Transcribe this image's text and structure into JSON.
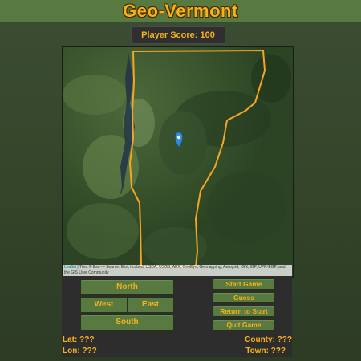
{
  "app": {
    "title": "Geo-Vermont",
    "score_label": "Player Score: 100"
  },
  "map": {
    "attribution_link": "Leaflet",
    "attribution_text": " | Tiles © Esri — Source: Esri, i-cubed, USDA, USGS, AEX, GeoEye, Getmapping, Aerogrid, IGN, IGP, UPR-EGP, and the GIS User Community",
    "marker_icon": "map-pin-icon",
    "boundary_color": "#f5a623",
    "marker_color": "#2f8be0"
  },
  "controls": {
    "directions": {
      "north": "North",
      "west": "West",
      "east": "East",
      "south": "South"
    },
    "actions": {
      "start_game": "Start Game",
      "guess": "Guess",
      "return_to_start": "Return to Start",
      "quit_game": "Quit Game"
    }
  },
  "info": {
    "lat": "Lat: ???",
    "lon": "Lon: ???",
    "county": "County: ???",
    "town": "Town: ???"
  },
  "theme": {
    "accent": "#f6b21b",
    "button_green": "#587a41",
    "panel_dark": "#2d2d2d"
  }
}
